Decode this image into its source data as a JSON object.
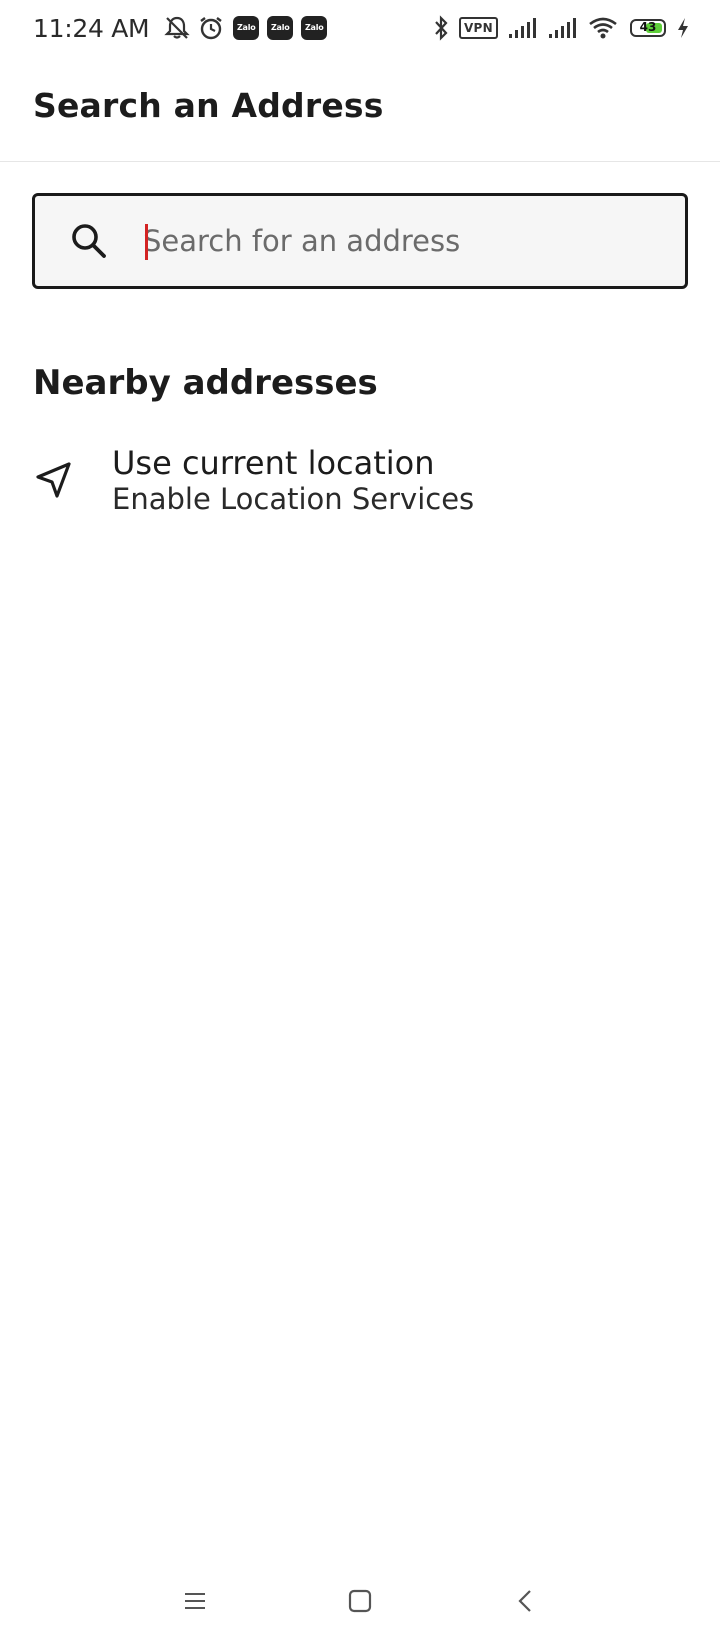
{
  "status_bar": {
    "time": "11:24 AM",
    "notification_icons": [
      "mute-notifications-icon",
      "alarm-icon",
      "zalo-icon",
      "zalo-icon",
      "zalo-icon"
    ],
    "zalo_label": "Zalo",
    "vpn_label": "VPN",
    "battery_level": "43",
    "system_icons": [
      "bluetooth-icon",
      "vpn-icon",
      "signal-icon",
      "signal-icon",
      "wifi-icon",
      "battery-icon",
      "charging-icon"
    ],
    "battery_color": "#5fcf3a"
  },
  "header": {
    "title": "Search an Address"
  },
  "search": {
    "placeholder": "Search for an address",
    "value": "",
    "caret_color": "#d32323"
  },
  "nearby": {
    "title": "Nearby addresses",
    "items": [
      {
        "icon": "navigation-arrow-icon",
        "title": "Use current location",
        "subtitle": "Enable Location Services"
      }
    ]
  },
  "nav_bar": {
    "buttons": [
      "menu-icon",
      "home-icon",
      "back-icon"
    ]
  }
}
